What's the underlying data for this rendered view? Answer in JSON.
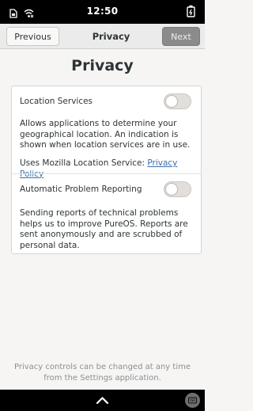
{
  "status": {
    "time": "12:50"
  },
  "header": {
    "previous_label": "Previous",
    "title": "Privacy",
    "next_label": "Next"
  },
  "page": {
    "title": "Privacy"
  },
  "location": {
    "label": "Location Services",
    "enabled": false,
    "description": "Allows applications to determine your geographical location. An indication is shown when location services are in use.",
    "uses_prefix": "Uses Mozilla Location Service: ",
    "policy_link": "Privacy Policy"
  },
  "reporting": {
    "label": "Automatic Problem Reporting",
    "enabled": false,
    "description": "Sending reports of technical problems helps us to improve PureOS. Reports are sent anonymously and are scrubbed of personal data."
  },
  "footer": {
    "note": "Privacy controls can be changed at any time from the Settings application."
  },
  "icons": {
    "status_left": [
      "sim-icon",
      "wifi-icon"
    ],
    "status_right": "battery-icon",
    "bottom_center": "chevron-up-icon",
    "bottom_right": "keyboard-icon"
  },
  "colors": {
    "accent_link": "#3d6ea8",
    "next_button_bg": "#8b8b8b"
  }
}
